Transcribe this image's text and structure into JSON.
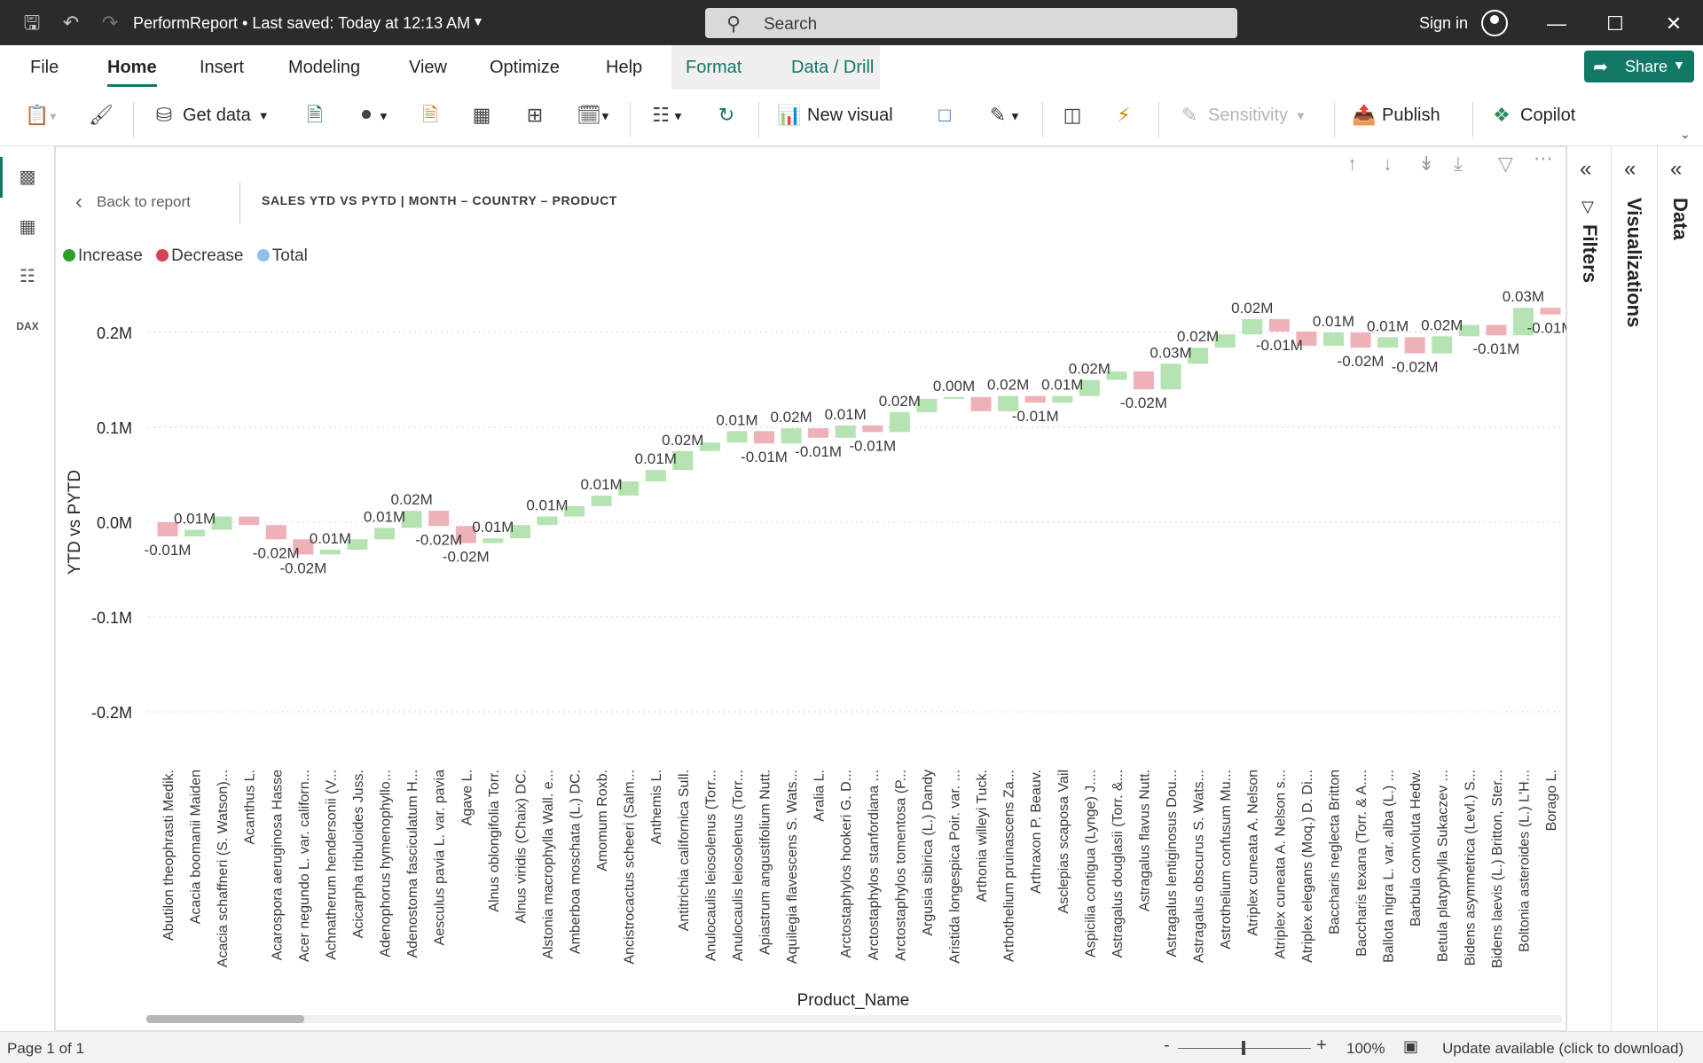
{
  "titlebar": {
    "doc_title": "PerformReport • Last saved: Today at 12:13 AM",
    "search_placeholder": "Search",
    "sign_in": "Sign in"
  },
  "ribbon": {
    "tabs": [
      "File",
      "Home",
      "Insert",
      "Modeling",
      "View",
      "Optimize",
      "Help",
      "Format",
      "Data / Drill"
    ],
    "active_tab": "Home",
    "share_label": "Share",
    "toolbar": {
      "get_data": "Get data",
      "new_visual": "New visual",
      "sensitivity": "Sensitivity",
      "publish": "Publish",
      "copilot": "Copilot"
    }
  },
  "right_panes": {
    "filters": "Filters",
    "visualizations": "Visualizations",
    "data": "Data"
  },
  "visual": {
    "back_label": "Back to report",
    "title": "SALES YTD VS PYTD | MONTH – COUNTRY – PRODUCT",
    "legend": [
      {
        "label": "Increase",
        "color": "#2ca02c"
      },
      {
        "label": "Decrease",
        "color": "#d64550"
      },
      {
        "label": "Total",
        "color": "#8fbfef"
      }
    ]
  },
  "colors": {
    "increase_fill": "#b5e3b2",
    "decrease_fill": "#eeb1b8",
    "accent": "#117865"
  },
  "chart_data": {
    "type": "waterfall",
    "xlabel": "Product_Name",
    "ylabel": "YTD vs PYTD",
    "y_ticks": [
      "0.2M",
      "0.1M",
      "0.0M",
      "-0.1M",
      "-0.2M"
    ],
    "ylim": [
      -0.2,
      0.2
    ],
    "grid": true,
    "categories": [
      "Abutilon theophrasti Medik.",
      "Acacia boomanii Maiden",
      "Acacia schaffneri (S. Watson)...",
      "Acanthus L.",
      "Acarospora aeruginosa Hasse",
      "Acer negundo L. var. californ...",
      "Achnatherum hendersonii (V...",
      "Acicarpha tribuloides Juss.",
      "Adenophorus hymenophyllo...",
      "Adenostoma fasciculatum H...",
      "Aesculus pavia L. var. pavia",
      "Agave L.",
      "Alnus oblongifolia Torr.",
      "Alnus viridis (Chaix) DC.",
      "Alstonia macrophylla Wall. e...",
      "Amberboa moschata (L.) DC.",
      "Amomum Roxb.",
      "Ancistrocactus scheeri (Salm...",
      "Anthemis L.",
      "Antitrichia californica Sull.",
      "Anulocaulis leiosolenus (Torr...",
      "Anulocaulis leiosolenus (Torr...",
      "Apiastrum angustifolium Nutt.",
      "Aquilegia flavescens S. Wats...",
      "Aralia L.",
      "Arctostaphylos hookeri G. D...",
      "Arctostaphylos stanfordiana ...",
      "Arctostaphylos tomentosa (P...",
      "Argusia sibirica (L.) Dandy",
      "Aristida longespica Poir. var. ...",
      "Arthonia willeyi Tuck.",
      "Arthothelium pruinascens Za...",
      "Arthraxon P. Beauv.",
      "Asclepias scaposa Vail",
      "Aspicilia contigua (Lynge) J....",
      "Astragalus douglasii (Torr. &...",
      "Astragalus flavus Nutt.",
      "Astragalus lentiginosus Dou...",
      "Astragalus obscurus S. Wats...",
      "Astrothelium confusum Mu...",
      "Atriplex cuneata A. Nelson",
      "Atriplex cuneata A. Nelson s...",
      "Atriplex elegans (Moq.) D. Di...",
      "Baccharis neglecta Britton",
      "Baccharis texana (Torr. & A....",
      "Ballota nigra L. var. alba (L.) ...",
      "Barbula convoluta Hedw.",
      "Betula platyphylla Sukaczev ...",
      "Bidens asymmetrica (Levl.) S...",
      "Bidens laevis (L.) Britton, Ster...",
      "Boltonia asteroides (L.) L'H...",
      "Borago L."
    ],
    "values": [
      -0.015,
      0.007,
      0.014,
      -0.009,
      -0.015,
      -0.016,
      0.005,
      0.011,
      0.012,
      0.018,
      -0.016,
      -0.018,
      0.005,
      0.014,
      0.009,
      0.011,
      0.011,
      0.015,
      0.012,
      0.02,
      0.009,
      0.012,
      -0.013,
      0.016,
      -0.01,
      0.013,
      -0.007,
      0.021,
      0.014,
      0.002,
      -0.015,
      0.016,
      -0.007,
      0.007,
      0.017,
      0.009,
      -0.019,
      0.027,
      0.017,
      0.014,
      0.016,
      -0.013,
      -0.015,
      0.014,
      -0.016,
      0.011,
      -0.017,
      0.018,
      0.012,
      -0.011,
      0.029,
      -0.007
    ],
    "data_labels": [
      "-0.01M",
      "0.01M",
      "",
      "",
      "-0.02M",
      "-0.02M",
      "0.01M",
      "",
      "0.01M",
      "0.02M",
      "-0.02M",
      "-0.02M",
      "0.01M",
      "",
      "0.01M",
      "",
      "0.01M",
      "",
      "0.01M",
      "0.02M",
      "",
      "0.01M",
      "-0.01M",
      "0.02M",
      "-0.01M",
      "0.01M",
      "-0.01M",
      "0.02M",
      "",
      "0.00M",
      "",
      "0.02M",
      "-0.01M",
      "0.01M",
      "0.02M",
      "",
      "-0.02M",
      "0.03M",
      "0.02M",
      "",
      "0.02M",
      "-0.01M",
      "",
      "0.01M",
      "-0.02M",
      "0.01M",
      "-0.02M",
      "0.02M",
      "",
      "-0.01M",
      "0.03M",
      "-0.01M"
    ]
  },
  "statusbar": {
    "page": "Page 1 of 1",
    "zoom": "100%",
    "update": "Update available (click to download)"
  }
}
